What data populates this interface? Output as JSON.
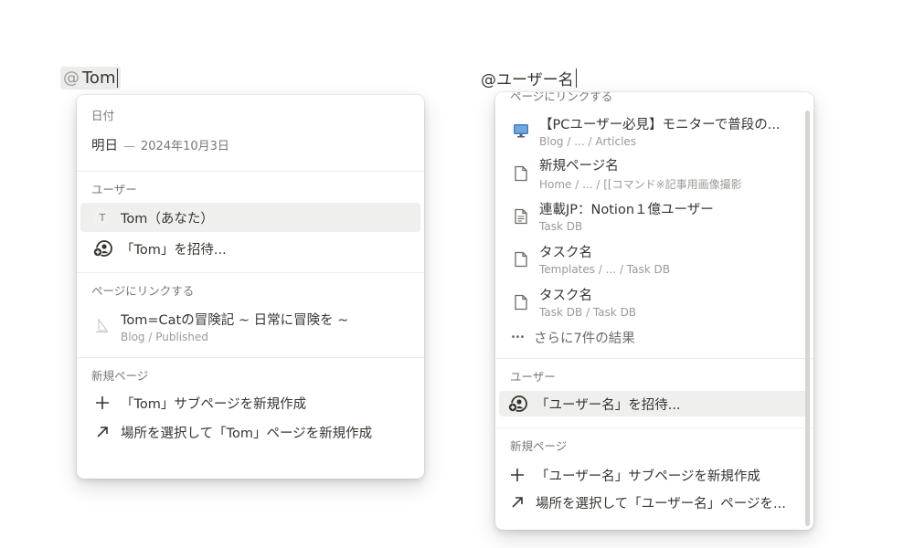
{
  "left": {
    "mention": {
      "at": "@",
      "text": "Tom"
    },
    "date_section": {
      "title": "日付",
      "label": "明日",
      "dash": "—",
      "date": "2024年10月3日"
    },
    "user_section": {
      "title": "ユーザー",
      "user_avatar_letter": "T",
      "user_label": "Tom（あなた）",
      "invite_label": "「Tom」を招待..."
    },
    "link_section": {
      "title": "ページにリンクする",
      "page_label": "Tom=Catの冒険記 ~ 日常に冒険を ~",
      "page_path": "Blog / Published"
    },
    "new_page_section": {
      "title": "新規ページ",
      "subpage_label": "「Tom」サブページを新規作成",
      "choose_label": "場所を選択して「Tom」ページを新規作成"
    }
  },
  "right": {
    "mention": {
      "text": "@ユーザー名"
    },
    "link_section": {
      "title": "ページにリンクする",
      "pages": [
        {
          "label": "【PCユーザー必見】モニターで普段の...",
          "path": "Blog / ... / Articles",
          "icon": "monitor-icon"
        },
        {
          "label": "新規ページ名",
          "path": "Home / ... / [[コマンド※記事用画像撮影",
          "icon": "page-icon"
        },
        {
          "label": "連載JP：Notion１億ユーザー",
          "path": "Task DB",
          "icon": "page-text-icon"
        },
        {
          "label": "タスク名",
          "path": "Templates / ... / Task DB",
          "icon": "page-icon"
        },
        {
          "label": "タスク名",
          "path": "Task DB / Task DB",
          "icon": "page-icon"
        }
      ],
      "more_dots": "•••",
      "more_label": "さらに7件の結果"
    },
    "user_section": {
      "title": "ユーザー",
      "invite_label": "「ユーザー名」を招待..."
    },
    "new_page_section": {
      "title": "新規ページ",
      "subpage_label": "「ユーザー名」サブページを新規作成",
      "choose_label": "場所を選択して「ユーザー名」ページを..."
    }
  }
}
